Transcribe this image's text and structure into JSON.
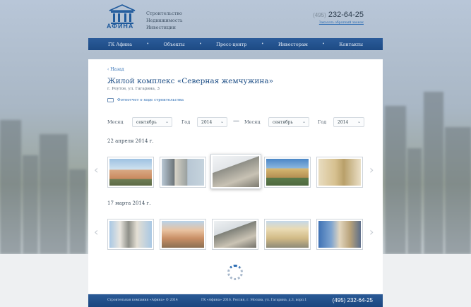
{
  "brand": {
    "logo_text": "АФИНА",
    "tagline": [
      "Строительство",
      "Недвижимость",
      "Инвестиции"
    ]
  },
  "header": {
    "phone_code": "(495)",
    "phone_number": "232-64-25",
    "callback_link": "Заказать обратный звонок"
  },
  "nav": {
    "items": [
      "ГК Афина",
      "Объекты",
      "Пресс-центр",
      "Инвесторам",
      "Контакты"
    ]
  },
  "page": {
    "back_link": "‹ Назад",
    "title": "Жилой комплекс «Северная жемчужина»",
    "address": "г. Реутов, ул. Гагарина, 3",
    "print_link": "Фотоотчет о ходе строительства"
  },
  "filters": {
    "from_month_label": "Месяц",
    "from_month_value": "сентябрь",
    "from_year_label": "Год",
    "from_year_value": "2014",
    "separator": "—",
    "to_month_label": "Месяц",
    "to_month_value": "сентябрь",
    "to_year_label": "Год",
    "to_year_value": "2014"
  },
  "galleries": [
    {
      "date": "22 апреля 2014 г."
    },
    {
      "date": "17 марта 2014 г."
    }
  ],
  "footer": {
    "copyright": "Строительная компания «Афина» © 2014",
    "address": "ГК «Афина» 2016. Россия, г. Москва, ул. Гагарина, д.3, корп.1",
    "phone": "(495) 232-64-25"
  },
  "colors": {
    "accent": "#1d4e86",
    "nav_bg": "#2b5c9a",
    "link": "#2b6cb3"
  }
}
